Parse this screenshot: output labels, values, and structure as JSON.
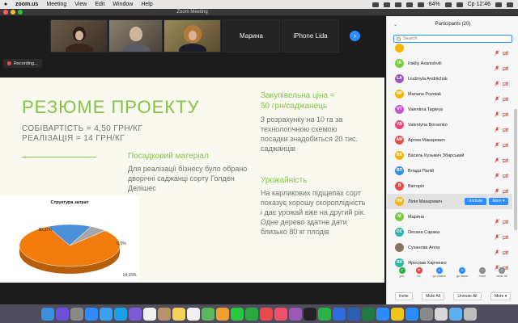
{
  "menubar": {
    "app": "zoom.us",
    "items": [
      "Meeting",
      "View",
      "Edit",
      "Window",
      "Help"
    ],
    "battery": "84%",
    "datetime": "Ср 12:46"
  },
  "window": {
    "title": "Zoom Meeting"
  },
  "video_strip": {
    "tiles": [
      {
        "type": "video"
      },
      {
        "type": "video"
      },
      {
        "type": "video"
      },
      {
        "type": "name",
        "label": "Марина"
      },
      {
        "type": "name",
        "label": "iPhone Lida"
      }
    ],
    "next_icon": "chevron-right-icon"
  },
  "recording": {
    "label": "Recording..."
  },
  "slide": {
    "title": "РЕЗЮМЕ ПРОЕКТУ",
    "cost_line1": "СОБІВАРТІСТЬ = 4,50 ГРН/КГ",
    "cost_line2": "РЕАЛІЗАЦІЯ = 14 ГРН/КГ",
    "planting": {
      "heading": "Посадковий матеріал",
      "text": "Для реалізації бізнесу було обрано дворічні саджанці сорту Голден Делішес"
    },
    "price": {
      "heading_line1": "Закупівельна ціна =",
      "heading_line2": "50 грн/саджанець",
      "text": "3 розрахунку на 10 га за технологічною схемою посадки знадобиться 20 тис. саджанців"
    },
    "yield": {
      "heading": "Урожайність",
      "text": "На карликових підщепах сорт показує хорошу скороплідність і дає урожай вже на другий рік. Одне дерево здатне дати близько 80 кг плодів"
    }
  },
  "chart_data": {
    "type": "pie",
    "title": "Структура затрат",
    "slices": [
      {
        "label": "80,37%",
        "value": 80.37,
        "color": "#f27d0c"
      },
      {
        "label": "14,15%",
        "value": 14.15,
        "color": "#4a90d9"
      },
      {
        "label": "5,5%",
        "value": 5.5,
        "color": "#a7a7a7"
      }
    ]
  },
  "participants": {
    "title": "Participants (20)",
    "search_placeholder": "Search",
    "list": [
      {
        "initials": "",
        "name": "",
        "color": "#f5b400"
      },
      {
        "initials": "IA",
        "name": "Irakliy Asanishvili",
        "color": "#7ac943"
      },
      {
        "initials": "LA",
        "name": "Liudmyla Andriichuk",
        "color": "#9b59b6"
      },
      {
        "initials": "MP",
        "name": "Mariana Pozniak",
        "color": "#f5b400"
      },
      {
        "initials": "VT",
        "name": "Valentina Tagieva",
        "color": "#c056c9"
      },
      {
        "initials": "VB",
        "name": "Valentyna Borsenko",
        "color": "#e8457c"
      },
      {
        "initials": "AM",
        "name": "Артем Макаревич",
        "color": "#e84a4a"
      },
      {
        "initials": "ВК",
        "name": "Василь Кузьмич Збарський",
        "color": "#f5b400"
      },
      {
        "initials": "ВП",
        "name": "Влада Палій",
        "color": "#2d8cff"
      },
      {
        "initials": "В",
        "name": "Вікторія",
        "color": "#e84a4a"
      },
      {
        "initials": "ЛМ",
        "name": "Лілія Макаревич",
        "color": "#f5b400",
        "selected": true,
        "unmute_label": "Unmute",
        "more_label": "More ▾"
      },
      {
        "initials": "М",
        "name": "Марина",
        "color": "#7ac943"
      },
      {
        "initials": "ОС",
        "name": "Оксана Сарака",
        "color": "#2ab5a5"
      },
      {
        "initials": "",
        "name": "Суханова Алла",
        "color": "#8a7560"
      },
      {
        "initials": "ЯХ",
        "name": "Ярослав Харченко",
        "color": "#2ab5a5"
      }
    ],
    "reactions": [
      {
        "label": "yes",
        "symbol": "✓",
        "color": "#28b446"
      },
      {
        "label": "no",
        "symbol": "✕",
        "color": "#e84a4a"
      },
      {
        "label": "go slower",
        "symbol": "«",
        "color": "#2d8cff"
      },
      {
        "label": "go faster",
        "symbol": "»",
        "color": "#2d8cff"
      },
      {
        "label": "more",
        "symbol": "⋯",
        "color": "#8a8a8a"
      },
      {
        "label": "clear all",
        "symbol": "○",
        "color": "#8a8a8a"
      }
    ],
    "buttons": {
      "invite": "Invite",
      "mute_all": "Mute All",
      "unmute_all": "Unmute All",
      "more": "More ▾"
    }
  },
  "dock": {
    "apps": [
      {
        "name": "finder-icon",
        "color": "#3d8fe0"
      },
      {
        "name": "siri-icon",
        "color": "#6b4fd8"
      },
      {
        "name": "launchpad-icon",
        "color": "#8a8a8a"
      },
      {
        "name": "safari-icon",
        "color": "#2d8cff"
      },
      {
        "name": "mail-icon",
        "color": "#3aa0f0"
      },
      {
        "name": "skype-icon",
        "color": "#1aa0e6"
      },
      {
        "name": "viber-icon",
        "color": "#7d5ad6"
      },
      {
        "name": "calendar-icon",
        "color": "#f0f0f0"
      },
      {
        "name": "contacts-icon",
        "color": "#b8946a"
      },
      {
        "name": "notes-icon",
        "color": "#f5d25a"
      },
      {
        "name": "reminders-icon",
        "color": "#f0f0f0"
      },
      {
        "name": "maps-icon",
        "color": "#5cb85c"
      },
      {
        "name": "photos-icon",
        "color": "#f0a030"
      },
      {
        "name": "messages-icon",
        "color": "#28c840"
      },
      {
        "name": "facetime-icon",
        "color": "#28a840"
      },
      {
        "name": "news-icon",
        "color": "#e84a4a"
      },
      {
        "name": "music-icon",
        "color": "#f0506e"
      },
      {
        "name": "podcasts-icon",
        "color": "#9b59b6"
      },
      {
        "name": "tv-icon",
        "color": "#222222"
      },
      {
        "name": "numbers-icon",
        "color": "#28b446"
      },
      {
        "name": "keynote-icon",
        "color": "#2d6cdf"
      },
      {
        "name": "word-icon",
        "color": "#2b5fb4"
      },
      {
        "name": "excel-icon",
        "color": "#1e7a3f"
      },
      {
        "name": "zoom-icon",
        "color": "#2d8cff"
      },
      {
        "name": "chrome-icon",
        "color": "#f0c419"
      },
      {
        "name": "appstore-icon",
        "color": "#2d8cff"
      },
      {
        "name": "preferences-icon",
        "color": "#8a8a8a"
      },
      {
        "name": "preview-icon",
        "color": "#d8d8d8"
      },
      {
        "name": "folder-icon",
        "color": "#5ab0f0"
      },
      {
        "name": "trash-icon",
        "color": "#bdbdbd"
      }
    ]
  }
}
